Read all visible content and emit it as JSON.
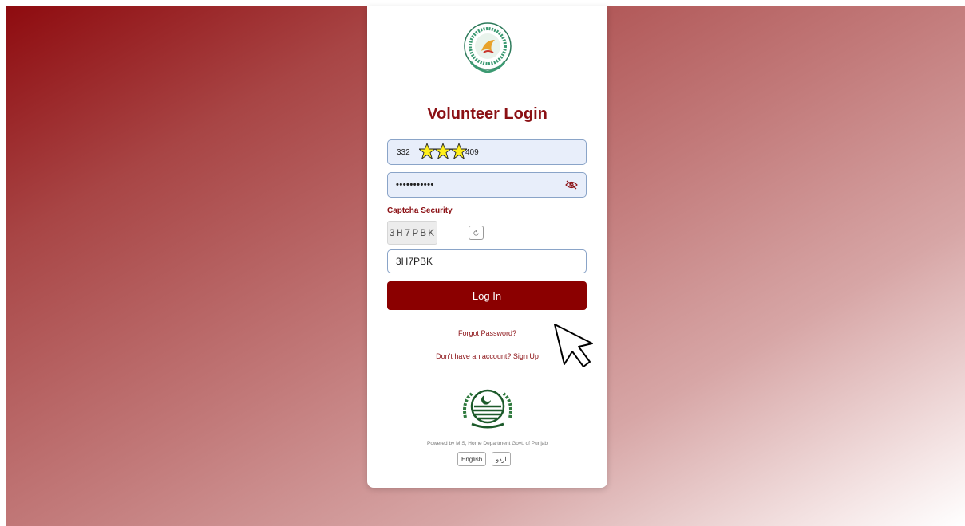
{
  "page": {
    "title": "Volunteer Login",
    "accent_color": "#8b0000"
  },
  "form": {
    "id_prefix": "332",
    "id_suffix": "409",
    "password_dots": "•••••••••••",
    "password_toggle_icon": "eye-slash-icon",
    "captcha_label": "Captcha Security",
    "captcha_code": "3H7PBK",
    "captcha_refresh_icon": "refresh-icon",
    "captcha_input_value": "3H7PBK",
    "login_label": "Log In"
  },
  "links": {
    "forgot": "Forgot Password?",
    "signup": "Don't have an account? Sign Up"
  },
  "footer": {
    "powered_by": "Powered by MIS, Home Department Govt. of Punjab",
    "lang_english": "English",
    "lang_urdu": "اردو"
  }
}
